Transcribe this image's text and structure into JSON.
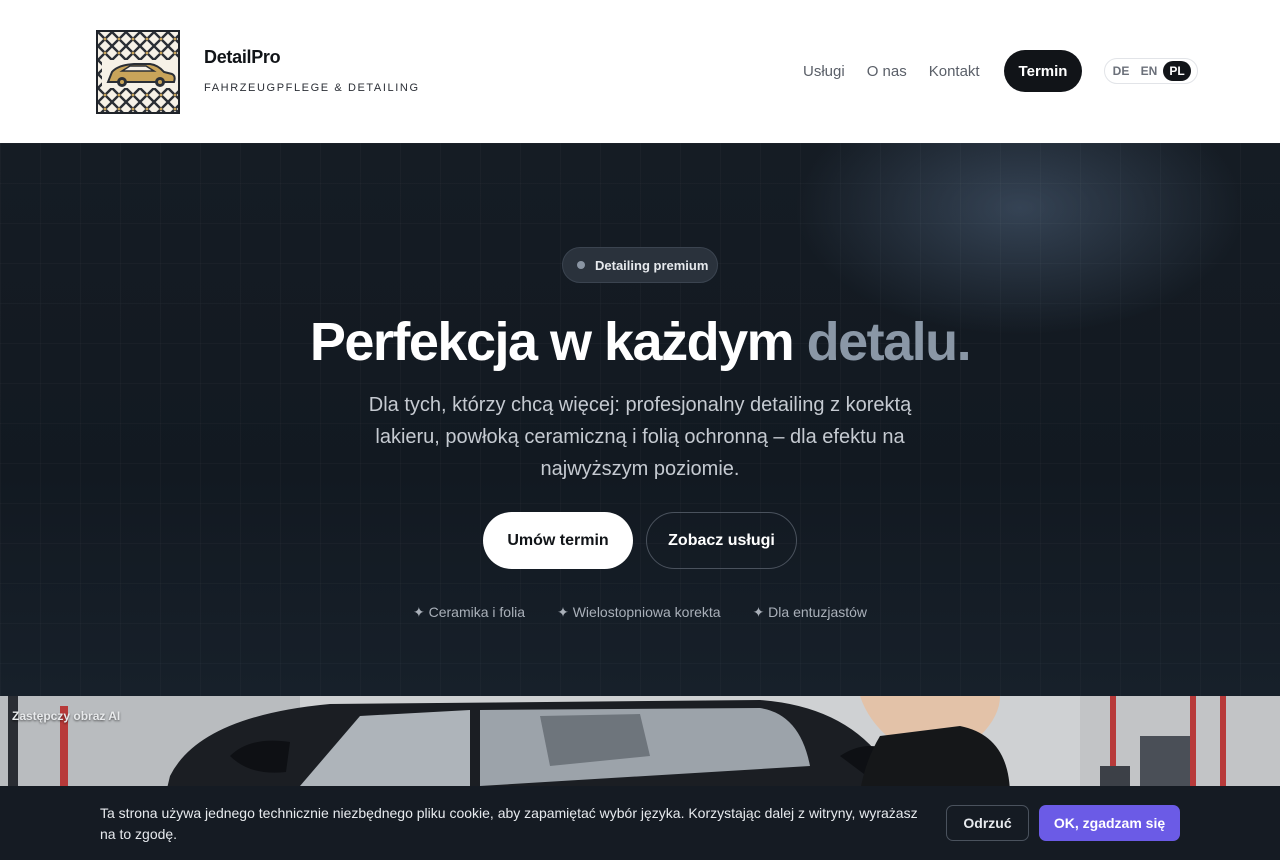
{
  "header": {
    "brand_name": "DetailPro",
    "brand_tagline": "FAHRZEUGPFLEGE & DETAILING",
    "nav": [
      "Usługi",
      "O nas",
      "Kontakt"
    ],
    "cta": "Termin",
    "languages": [
      "DE",
      "EN",
      "PL"
    ],
    "active_language": "PL",
    "logo_icon": "car-diamond-pattern-logo"
  },
  "hero": {
    "badge": "Detailing premium",
    "headline_main": "Perfekcja w każdym ",
    "headline_accent": "detalu.",
    "subheadline": "Dla tych, którzy chcą więcej: profesjonalny detailing z korektą lakieru, powłoką ceramiczną i folią ochronną – dla efektu na najwyższym poziomie.",
    "primary_button": "Umów termin",
    "secondary_button": "Zobacz usługi",
    "features": [
      "✦ Ceramika i folia",
      "✦ Wielostopniowa korekta",
      "✦ Dla entuzjastów"
    ]
  },
  "photo": {
    "label": "Zastępczy obraz AI"
  },
  "cookie": {
    "text": "Ta strona używa jednego technicznie niezbędnego pliku cookie, aby zapamiętać wybór języka. Korzystając dalej z witryny, wyrażasz na to zgodę.",
    "decline": "Odrzuć",
    "accept": "OK, zgadzam się"
  },
  "colors": {
    "accent_purple": "#6b5be6",
    "dark": "#111418",
    "headline_accent": "#8a97a6"
  }
}
